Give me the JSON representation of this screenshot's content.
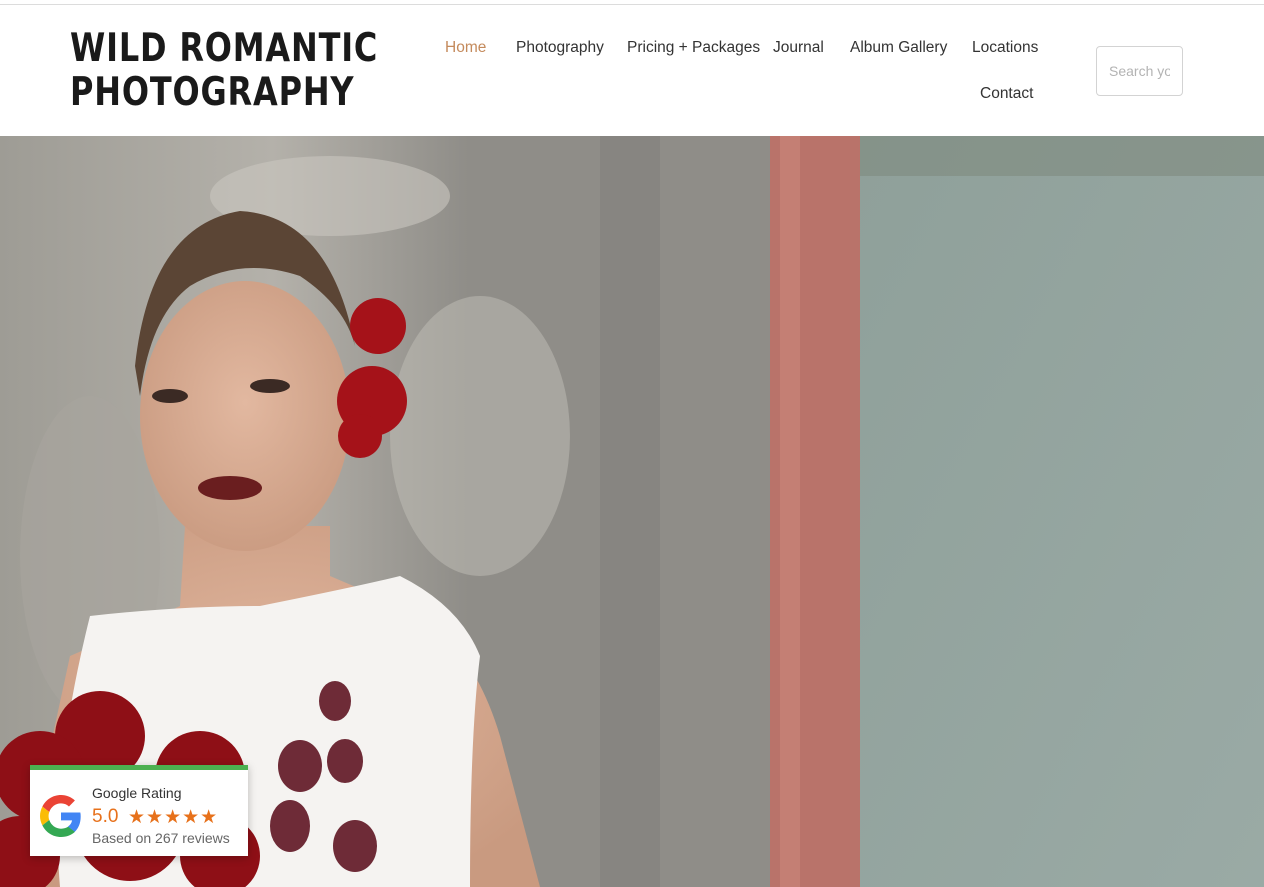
{
  "logo": {
    "line1": "WILD ROMANTIC",
    "line2": "PHOTOGRAPHY"
  },
  "nav": {
    "items": [
      {
        "label": "Home",
        "active": true
      },
      {
        "label": "Photography",
        "active": false
      },
      {
        "label": "Pricing + Packages",
        "active": false
      },
      {
        "label": "Journal",
        "active": false
      },
      {
        "label": "Album Gallery",
        "active": false
      },
      {
        "label": "Locations",
        "active": false
      },
      {
        "label": "Contact",
        "active": false
      }
    ]
  },
  "search": {
    "placeholder": "Search your site"
  },
  "hero": {
    "image": "bride-with-red-roses-photo"
  },
  "google_rating": {
    "title": "Google Rating",
    "score": "5.0",
    "stars": "★★★★★",
    "star_count": 5,
    "reviews_text": "Based on 267 reviews",
    "icon": "google-g-icon"
  },
  "colors": {
    "accent": "#c48a5c",
    "nav_text": "#333333",
    "rating_orange": "#e7711b",
    "rating_bar": "#4cb050"
  }
}
